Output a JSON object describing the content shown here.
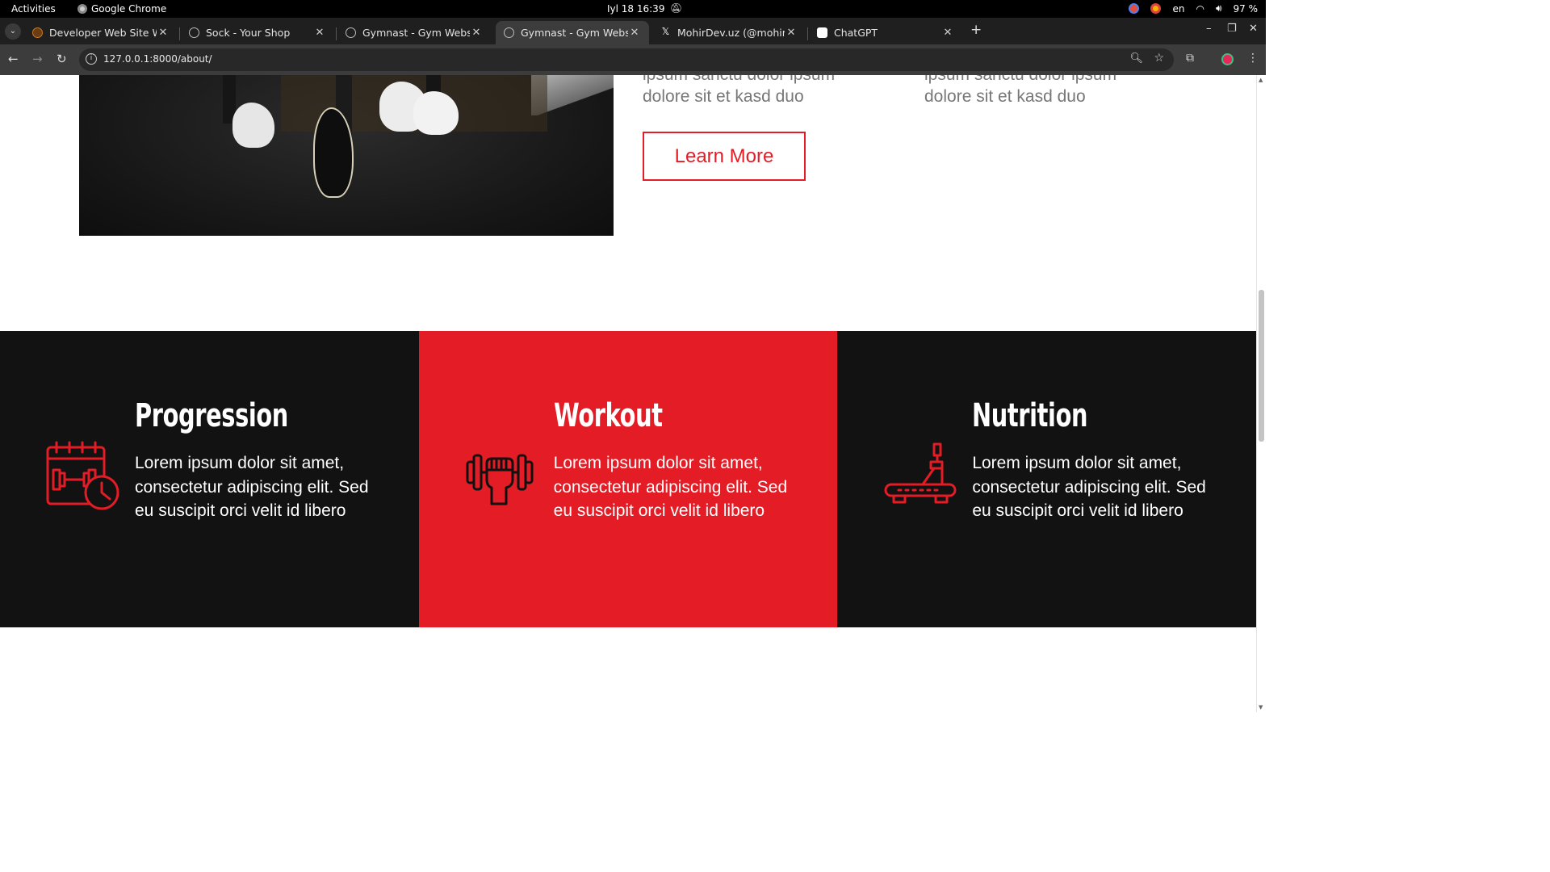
{
  "system": {
    "activities": "Activities",
    "app_name": "Google Chrome",
    "clock": "Iyl 18  16:39",
    "lang": "en",
    "battery": "97 %"
  },
  "browser": {
    "tabs": [
      {
        "title": "Developer Web Site Web"
      },
      {
        "title": "Sock - Your Shop"
      },
      {
        "title": "Gymnast - Gym Website"
      },
      {
        "title": "Gymnast - Gym Website"
      },
      {
        "title": "MohirDev.uz (@mohirde"
      },
      {
        "title": "ChatGPT"
      }
    ],
    "url": "127.0.0.1:8000/about/"
  },
  "page": {
    "intro_left_cut": "ipsum sanctu dolor ipsum",
    "intro_left_line": "dolore sit et kasd duo",
    "intro_right_cut": "ipsum sanctu dolor ipsum",
    "intro_right_line": "dolore sit et kasd duo",
    "learn_more": "Learn More",
    "features": [
      {
        "title": "Progression",
        "text": "Lorem ipsum dolor sit amet, consectetur adipiscing elit. Sed eu suscipit orci velit id libero",
        "icon": "calendar-dumbbell-icon"
      },
      {
        "title": "Workout",
        "text": "Lorem ipsum dolor sit amet, consectetur adipiscing elit. Sed eu suscipit orci velit id libero",
        "icon": "fist-dumbbell-icon"
      },
      {
        "title": "Nutrition",
        "text": "Lorem ipsum dolor sit amet, consectetur adipiscing elit. Sed eu suscipit orci velit id libero",
        "icon": "treadmill-icon"
      }
    ]
  },
  "colors": {
    "accent": "#e31c25",
    "dark": "#121212"
  }
}
